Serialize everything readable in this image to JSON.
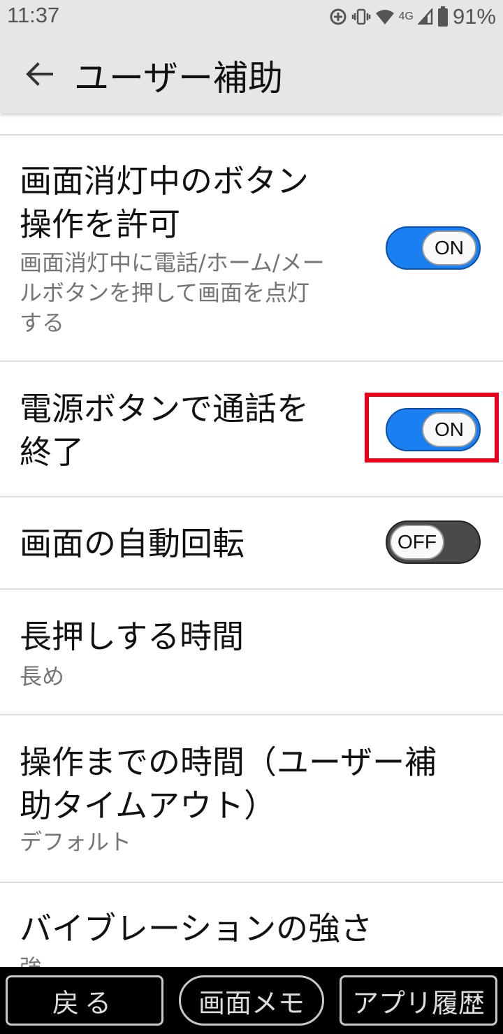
{
  "status_bar": {
    "time": "11:37",
    "network_label": "4G",
    "battery_percent": "91%",
    "icons": [
      "data-saver-icon",
      "vibrate-icon",
      "wifi-icon",
      "cell-signal-icon",
      "battery-icon"
    ]
  },
  "app_bar": {
    "title": "ユーザー補助",
    "back_icon": "arrow-left-icon"
  },
  "settings": {
    "items": [
      {
        "title": "画面消灯中のボタン\n操作を許可",
        "summary": "画面消灯中に電話/ホーム/メー\nルボタンを押して画面を点灯\nする",
        "toggle": "ON",
        "checked": true
      },
      {
        "title": "電源ボタンで通話を\n終了",
        "toggle": "ON",
        "checked": true,
        "highlighted": true
      },
      {
        "title": "画面の自動回転",
        "toggle": "OFF",
        "checked": false
      },
      {
        "title": "長押しする時間",
        "summary": "長め"
      },
      {
        "title": "操作までの時間（ユーザー補\n助タイムアウト）",
        "summary": "デフォルト"
      },
      {
        "title": "バイブレーションの強さ",
        "summary": "強"
      }
    ]
  },
  "bottom_bar": {
    "back_label": "戻る",
    "memo_label": "画面メモ",
    "history_label": "アプリ履歴"
  },
  "colors": {
    "toggle_on": "#1a7ff0",
    "toggle_off": "#4a4a4a",
    "highlight": "#e8001e",
    "app_bar_bg": "#e6e6e6"
  }
}
